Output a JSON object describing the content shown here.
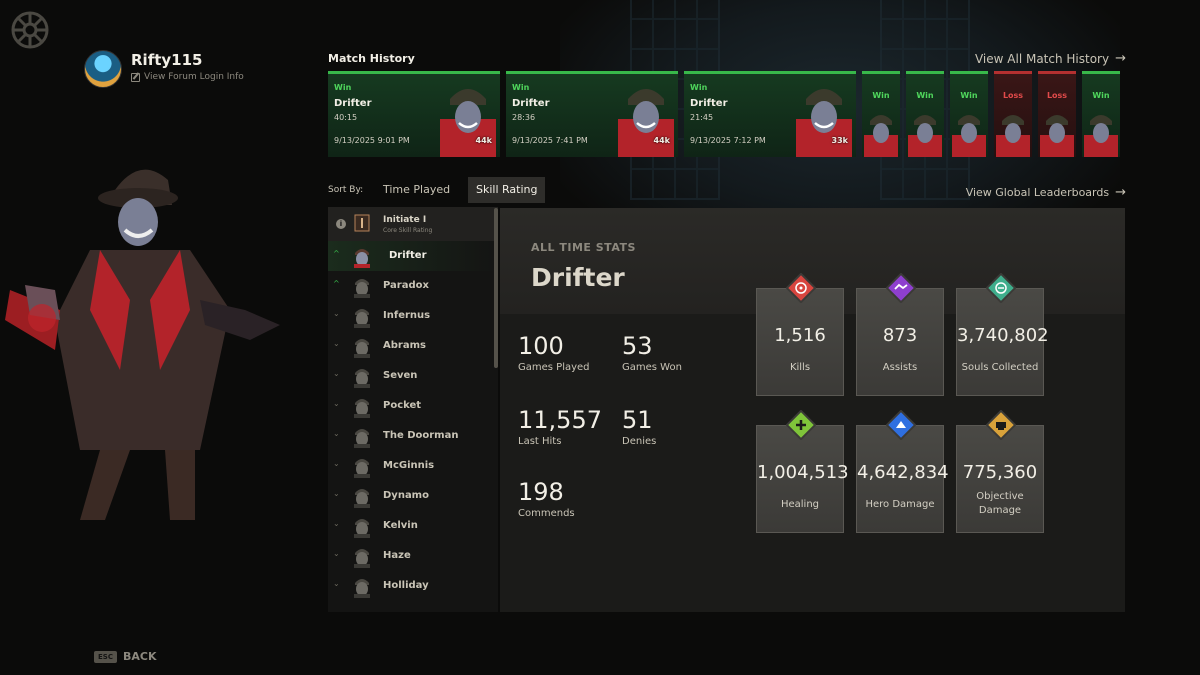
{
  "profile": {
    "username": "Rifty115",
    "forum_link": "View Forum Login Info"
  },
  "match_history": {
    "title": "Match History",
    "view_all": "View All Match History",
    "featured": [
      {
        "result": "Win",
        "hero": "Drifter",
        "duration": "40:15",
        "date": "9/13/2025 9:01 PM",
        "souls": "44k"
      },
      {
        "result": "Win",
        "hero": "Drifter",
        "duration": "28:36",
        "date": "9/13/2025 7:41 PM",
        "souls": "44k"
      },
      {
        "result": "Win",
        "hero": "Drifter",
        "duration": "21:45",
        "date": "9/13/2025 7:12 PM",
        "souls": "33k"
      }
    ],
    "compact": [
      {
        "result": "Win"
      },
      {
        "result": "Win"
      },
      {
        "result": "Win"
      },
      {
        "result": "Loss"
      },
      {
        "result": "Loss"
      },
      {
        "result": "Win"
      }
    ]
  },
  "sort": {
    "label": "Sort By:",
    "options": [
      "Time Played",
      "Skill Rating"
    ],
    "selected": "Skill Rating"
  },
  "leaderboards_link": "View Global Leaderboards",
  "rank": {
    "info_icon": "i",
    "name": "Initiate I",
    "subtitle": "Core Skill Rating"
  },
  "heroes": [
    {
      "name": "Drifter",
      "active": true,
      "trend": "up"
    },
    {
      "name": "Paradox",
      "active": false,
      "trend": "up"
    },
    {
      "name": "Infernus",
      "active": false,
      "trend": "down"
    },
    {
      "name": "Abrams",
      "active": false,
      "trend": "down"
    },
    {
      "name": "Seven",
      "active": false,
      "trend": "down"
    },
    {
      "name": "Pocket",
      "active": false,
      "trend": "down"
    },
    {
      "name": "The Doorman",
      "active": false,
      "trend": "down"
    },
    {
      "name": "McGinnis",
      "active": false,
      "trend": "down"
    },
    {
      "name": "Dynamo",
      "active": false,
      "trend": "down"
    },
    {
      "name": "Kelvin",
      "active": false,
      "trend": "down"
    },
    {
      "name": "Haze",
      "active": false,
      "trend": "down"
    },
    {
      "name": "Holliday",
      "active": false,
      "trend": "down"
    }
  ],
  "stats": {
    "section_label": "ALL TIME STATS",
    "hero": "Drifter",
    "basic": [
      {
        "value": "100",
        "label": "Games Played"
      },
      {
        "value": "53",
        "label": "Games Won"
      },
      {
        "value": "11,557",
        "label": "Last Hits"
      },
      {
        "value": "51",
        "label": "Denies"
      },
      {
        "value": "198",
        "label": "Commends"
      }
    ],
    "tiles": [
      {
        "value": "1,516",
        "label": "Kills",
        "icon": "kills-icon",
        "color": "#d8453f"
      },
      {
        "value": "873",
        "label": "Assists",
        "icon": "assists-icon",
        "color": "#8e3fcf"
      },
      {
        "value": "3,740,802",
        "label": "Souls Collected",
        "icon": "souls-icon",
        "color": "#3fae8c"
      },
      {
        "value": "1,004,513",
        "label": "Healing",
        "icon": "healing-icon",
        "color": "#7fc43a"
      },
      {
        "value": "4,642,834",
        "label": "Hero Damage",
        "icon": "hero-damage-icon",
        "color": "#2f6fe0"
      },
      {
        "value": "775,360",
        "label": "Objective Damage",
        "icon": "objective-damage-icon",
        "color": "#d9a23a"
      }
    ]
  },
  "back": {
    "key": "ESC",
    "label": "BACK"
  }
}
